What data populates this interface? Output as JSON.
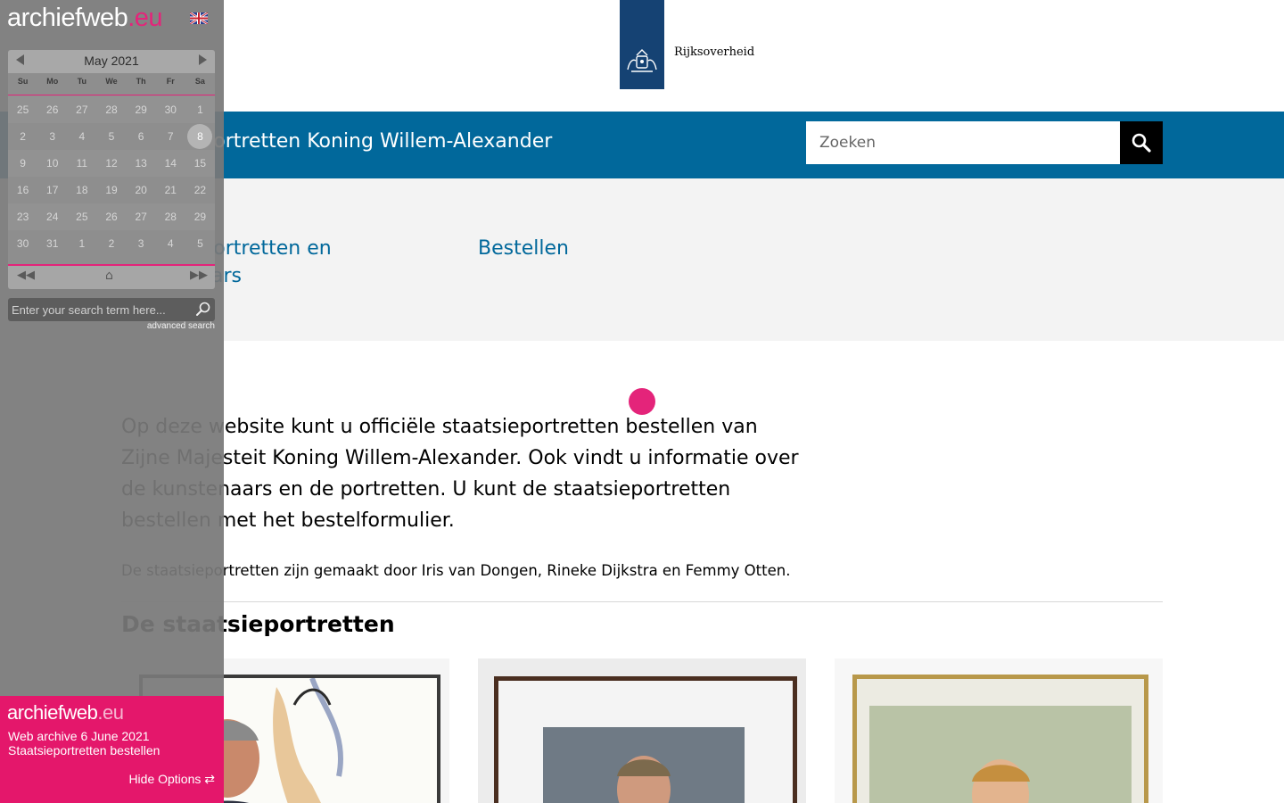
{
  "site": {
    "logo_text": "Rijksoverheid",
    "title": "Staatsieportretten Koning Willem-Alexander",
    "search_placeholder": "Zoeken",
    "nav": [
      {
        "label": "Staatsieportretten en kunstenaars"
      },
      {
        "label": "Bestellen"
      }
    ],
    "intro": "Op deze website kunt u officiële staatsieportretten bestellen van Zijne Majesteit Koning Willem-Alexander. Ook vindt u informatie over de kunstenaars en de portretten. U kunt de staatsieportretten bestellen met het bestelformulier.",
    "artists_line": "De staatsieportretten zijn gemaakt door Iris van Dongen, Rineke Dijkstra en Femmy Otten.",
    "section_title": "De staatsieportretten",
    "colors": {
      "brand_blue": "#01689b",
      "logo_blue": "#154273",
      "archive_pink": "#e4247a"
    }
  },
  "archive": {
    "logo_main": "archiefweb",
    "logo_tld": ".eu",
    "language_flag": "gb-flag-icon",
    "calendar": {
      "month_label": "May 2021",
      "weekdays": [
        "Su",
        "Mo",
        "Tu",
        "We",
        "Th",
        "Fr",
        "Sa"
      ],
      "weeks": [
        [
          "25",
          "26",
          "27",
          "28",
          "29",
          "30",
          "1"
        ],
        [
          "2",
          "3",
          "4",
          "5",
          "6",
          "7",
          "8"
        ],
        [
          "9",
          "10",
          "11",
          "12",
          "13",
          "14",
          "15"
        ],
        [
          "16",
          "17",
          "18",
          "19",
          "20",
          "21",
          "22"
        ],
        [
          "23",
          "24",
          "25",
          "26",
          "27",
          "28",
          "29"
        ],
        [
          "30",
          "31",
          "1",
          "2",
          "3",
          "4",
          "5"
        ]
      ],
      "selected_day": "8",
      "nav_first": "◀◀",
      "nav_home": "⌂",
      "nav_last": "▶▶"
    },
    "search_placeholder": "Enter your search term here...",
    "advanced_search": "advanced search",
    "archive_date": "Web archive 6 June 2021",
    "page_title": "Staatsieportretten bestellen",
    "hide_options": "Hide Options ⇄"
  }
}
